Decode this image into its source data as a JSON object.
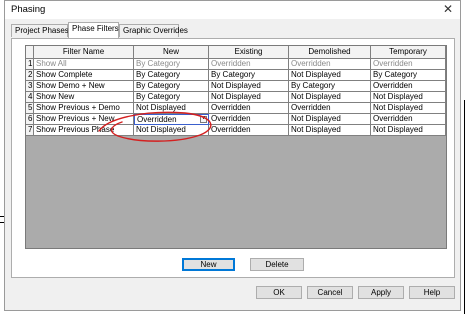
{
  "window": {
    "title": "Phasing"
  },
  "tabs": [
    {
      "label": "Project Phases",
      "active": false
    },
    {
      "label": "Phase Filters",
      "active": true
    },
    {
      "label": "Graphic Overrides",
      "active": false
    }
  ],
  "table": {
    "columns": [
      "",
      "Filter Name",
      "New",
      "Existing",
      "Demolished",
      "Temporary"
    ],
    "rows": [
      {
        "num": "1",
        "name": "Show All",
        "new": "By Category",
        "existing": "Overridden",
        "demolished": "Overridden",
        "temporary": "Overridden",
        "muted": true
      },
      {
        "num": "2",
        "name": "Show Complete",
        "new": "By Category",
        "existing": "By Category",
        "demolished": "Not Displayed",
        "temporary": "By Category",
        "muted": false
      },
      {
        "num": "3",
        "name": "Show Demo + New",
        "new": "By Category",
        "existing": "Not Displayed",
        "demolished": "By Category",
        "temporary": "Overridden",
        "muted": false
      },
      {
        "num": "4",
        "name": "Show New",
        "new": "By Category",
        "existing": "Not Displayed",
        "demolished": "Not Displayed",
        "temporary": "Not Displayed",
        "muted": false
      },
      {
        "num": "5",
        "name": "Show Previous + Demo",
        "new": "Not Displayed",
        "existing": "Overridden",
        "demolished": "Overridden",
        "temporary": "Not Displayed",
        "muted": false
      },
      {
        "num": "6",
        "name": "Show Previous + New",
        "new": "Overridden",
        "existing": "Overridden",
        "demolished": "Not Displayed",
        "temporary": "Overridden",
        "muted": false
      },
      {
        "num": "7",
        "name": "Show Previous Phase",
        "new": "Not Displayed",
        "existing": "Overridden",
        "demolished": "Not Displayed",
        "temporary": "Not Displayed",
        "muted": false
      }
    ],
    "dropdown_arrow": "˅"
  },
  "grid_buttons": {
    "new": "New",
    "delete": "Delete"
  },
  "footer_buttons": {
    "ok": "OK",
    "cancel": "Cancel",
    "apply": "Apply",
    "help": "Help"
  },
  "icons": {
    "close": "✕",
    "close_icon": "close-icon",
    "dropdown_icon": "chevron-down-icon"
  },
  "annotation": {
    "color": "#d42020"
  }
}
